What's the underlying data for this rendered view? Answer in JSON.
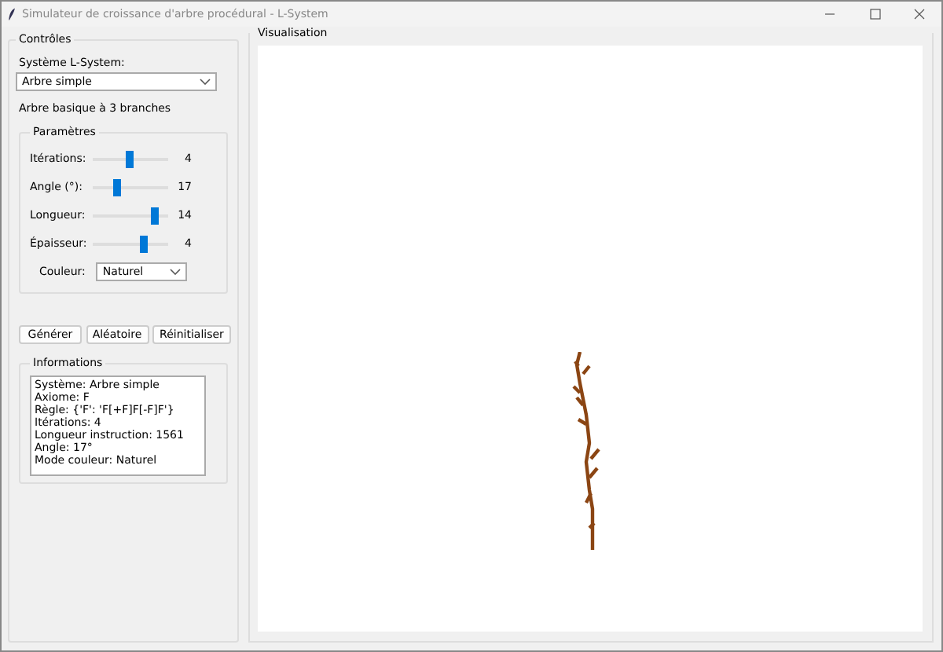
{
  "window": {
    "title": "Simulateur de croissance d'arbre procédural - L-System"
  },
  "controls": {
    "title": "Contrôles",
    "system_label": "Système L-System:",
    "system_value": "Arbre simple",
    "description": "Arbre basique à 3 branches",
    "parameters": {
      "title": "Paramètres",
      "sliders": [
        {
          "label": "Itérations:",
          "level": 0.48,
          "reading": "4"
        },
        {
          "label": "Angle (°):",
          "level": 0.3,
          "reading": "17"
        },
        {
          "label": "Longueur:",
          "level": 0.85,
          "reading": "14"
        },
        {
          "label": "Épaisseur:",
          "level": 0.7,
          "reading": "4"
        }
      ],
      "color_label": "Couleur:",
      "color_value": "Naturel"
    },
    "buttons": [
      "Générer",
      "Aléatoire",
      "Réinitialiser"
    ],
    "info": {
      "title": "Informations",
      "lines": [
        "Système: Arbre simple",
        "Axiome: F",
        "Règle: {'F': 'F[+F]F[-F]F'}",
        "Itérations: 4",
        "Longueur instruction: 1561",
        "Angle: 17°",
        "Mode couleur: Naturel"
      ]
    }
  },
  "visualization": {
    "title": "Visualisation"
  }
}
